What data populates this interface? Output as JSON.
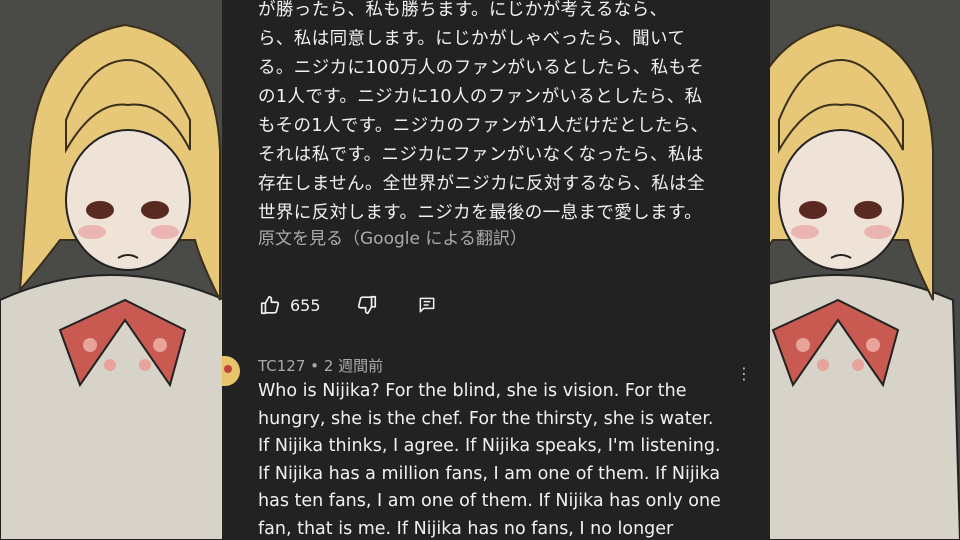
{
  "translated_comment_lines": [
    "が勝ったら、私も勝ちます。にじかが考えるなら、",
    "ら、私は同意します。にじかがしゃべったら、聞いて",
    "る。ニジカに100万人のファンがいるとしたら、私もそ",
    "の1人です。ニジカに10人のファンがいるとしたら、私",
    "もその1人です。ニジカのファンが1人だけだとしたら、",
    "それは私です。ニジカにファンがいなくなったら、私は",
    "存在しません。全世界がニジカに反対するなら、私は全",
    "世界に反対します。ニジカを最後の一息まで愛します。"
  ],
  "see_original": "原文を見る（Google による翻訳）",
  "actions": {
    "like_count": "655",
    "like_icon": "thumbs-up-icon",
    "dislike_icon": "thumbs-down-icon",
    "reply_icon": "reply-icon"
  },
  "next_comment": {
    "author": "TC127",
    "separator": "•",
    "time": "2 週間前",
    "lines": [
      "Who is Nijika? For the blind, she is vision. For the",
      "hungry, she is the chef. For the thirsty, she is water.",
      "If Nijika thinks, I agree. If Nijika speaks, I'm listening.",
      "If Nijika has a million fans, I am one of them. If Nijika",
      "has ten fans, I am one of them. If Nijika has only one",
      "fan, that is me. If Nijika has no fans, I no longer"
    ]
  },
  "colors": {
    "panel_bg": "#222222",
    "text": "#f1f1f1",
    "secondary_text": "#aaaaaa"
  }
}
